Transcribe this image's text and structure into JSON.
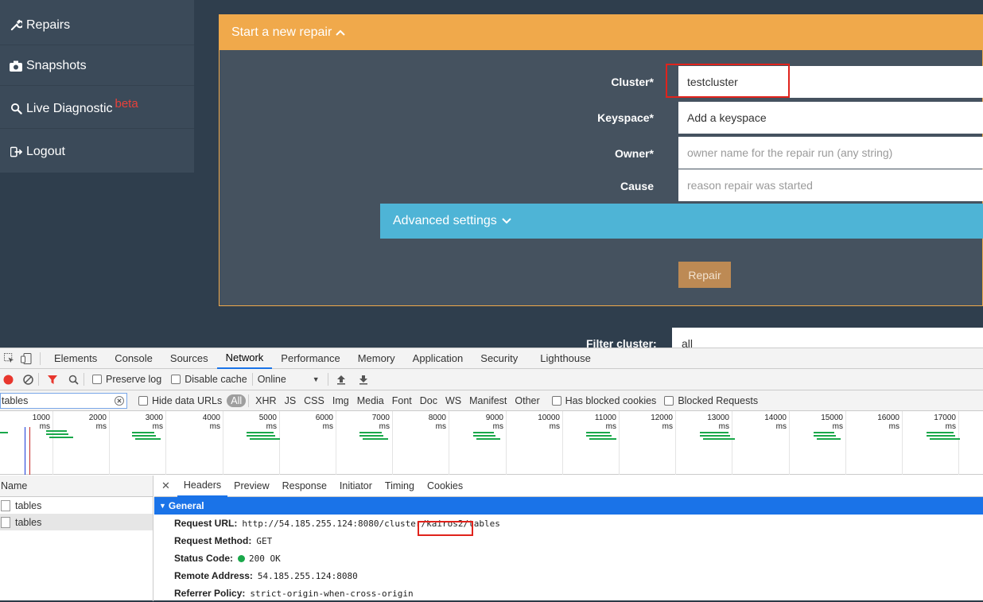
{
  "sidebar": {
    "items": [
      {
        "label": "Repairs",
        "icon": "wrench-icon"
      },
      {
        "label": "Snapshots",
        "icon": "camera-icon"
      },
      {
        "label": "Live Diagnostic",
        "badge": "beta",
        "icon": "search-icon"
      },
      {
        "label": "Logout",
        "icon": "logout-icon"
      }
    ]
  },
  "repair_form": {
    "header": "Start a new repair",
    "fields": [
      {
        "label": "Cluster*",
        "value": "testcluster",
        "placeholder": ""
      },
      {
        "label": "Keyspace*",
        "value": "Add a keyspace",
        "placeholder": ""
      },
      {
        "label": "Owner*",
        "value": "",
        "placeholder": "owner name for the repair run (any string)"
      },
      {
        "label": "Cause",
        "value": "",
        "placeholder": "reason repair was started"
      }
    ],
    "advanced_label": "Advanced settings",
    "repair_button": "Repair"
  },
  "filter": {
    "label": "Filter cluster:",
    "value": "all"
  },
  "devtools": {
    "tabs": [
      "Elements",
      "Console",
      "Sources",
      "Network",
      "Performance",
      "Memory",
      "Application",
      "Security",
      "Lighthouse"
    ],
    "active_tab": "Network",
    "toolbar": {
      "preserve_log": "Preserve log",
      "disable_cache": "Disable cache",
      "throttle": "Online"
    },
    "filter_value": "tables",
    "hide_data_urls": "Hide data URLs",
    "type_filters": [
      "All",
      "XHR",
      "JS",
      "CSS",
      "Img",
      "Media",
      "Font",
      "Doc",
      "WS",
      "Manifest",
      "Other"
    ],
    "has_blocked_cookies": "Has blocked cookies",
    "blocked_requests": "Blocked Requests",
    "timeline_ticks": [
      "1000 ms",
      "2000 ms",
      "3000 ms",
      "4000 ms",
      "5000 ms",
      "6000 ms",
      "7000 ms",
      "8000 ms",
      "9000 ms",
      "10000 ms",
      "11000 ms",
      "12000 ms",
      "13000 ms",
      "14000 ms",
      "15000 ms",
      "16000 ms",
      "17000 ms"
    ],
    "name_header": "Name",
    "requests": [
      "tables",
      "tables"
    ],
    "detail_tabs": [
      "Headers",
      "Preview",
      "Response",
      "Initiator",
      "Timing",
      "Cookies"
    ],
    "active_detail_tab": "Headers",
    "general_title": "General",
    "headers": [
      {
        "key": "Request URL:",
        "value": "http://54.185.255.124:8080/cluster/kairos2/tables"
      },
      {
        "key": "Request Method:",
        "value": "GET"
      },
      {
        "key": "Status Code:",
        "value": "200 OK"
      },
      {
        "key": "Remote Address:",
        "value": "54.185.255.124:8080"
      },
      {
        "key": "Referrer Policy:",
        "value": "strict-origin-when-cross-origin"
      }
    ]
  },
  "colors": {
    "accent_orange": "#f0a94b",
    "accent_blue": "#4eb4d6",
    "highlight_red": "#e0231c"
  }
}
